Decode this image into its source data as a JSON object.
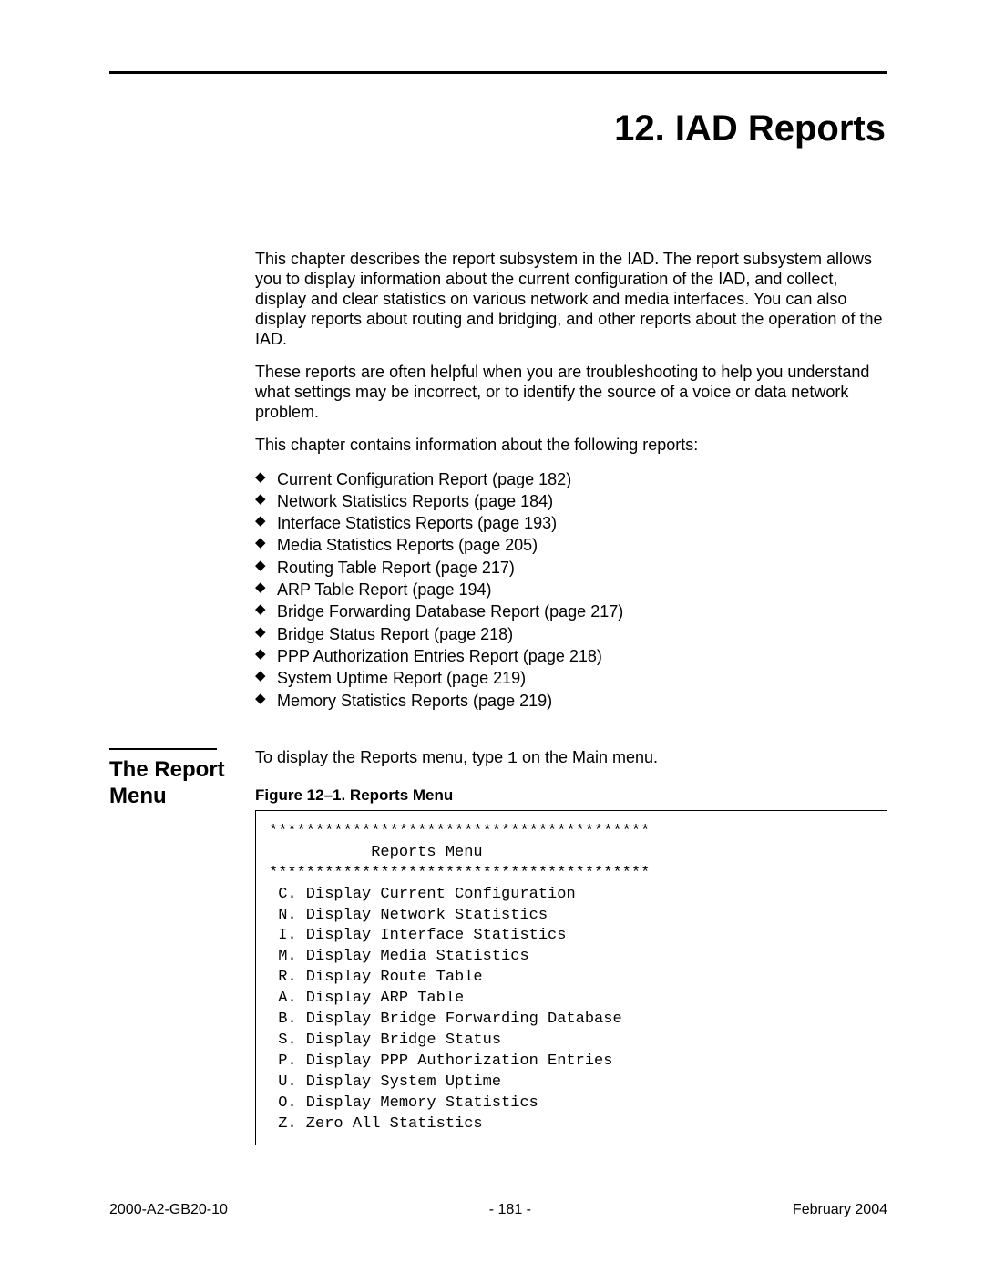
{
  "chapter": {
    "title": "12.  IAD Reports"
  },
  "intro": {
    "p1": "This chapter describes the report subsystem in the IAD. The report subsystem allows you to display information about the current configuration of the IAD, and collect, display and clear statistics on various network and media interfaces. You can also display reports about routing and bridging, and other reports about the operation of the IAD.",
    "p2": "These reports are often helpful when you are troubleshooting to help you understand what settings may be incorrect, or to identify the source of a voice or data network problem.",
    "p3": "This chapter contains information about the following reports:"
  },
  "report_list": [
    "Current Configuration Report (page 182)",
    "Network Statistics Reports (page 184)",
    "Interface Statistics Reports (page 193)",
    "Media Statistics Reports (page 205)",
    "Routing Table Report (page 217)",
    "ARP Table Report (page 194)",
    "Bridge Forwarding Database Report (page 217)",
    "Bridge Status Report (page 218)",
    "PPP Authorization Entries Report (page 218)",
    "System Uptime Report (page 219)",
    "Memory Statistics Reports (page 219)"
  ],
  "section": {
    "side_heading": "The Report Menu",
    "lead_before": "To display the Reports menu, type ",
    "lead_code": "1",
    "lead_after": " on the Main menu.",
    "figure_caption": "Figure 12–1.  Reports Menu",
    "menu_text": "*****************************************\n           Reports Menu\n*****************************************\n C. Display Current Configuration\n N. Display Network Statistics\n I. Display Interface Statistics\n M. Display Media Statistics\n R. Display Route Table\n A. Display ARP Table\n B. Display Bridge Forwarding Database\n S. Display Bridge Status\n P. Display PPP Authorization Entries\n U. Display System Uptime\n O. Display Memory Statistics\n Z. Zero All Statistics"
  },
  "footer": {
    "left": "2000-A2-GB20-10",
    "center": "- 181 -",
    "right": "February 2004"
  }
}
